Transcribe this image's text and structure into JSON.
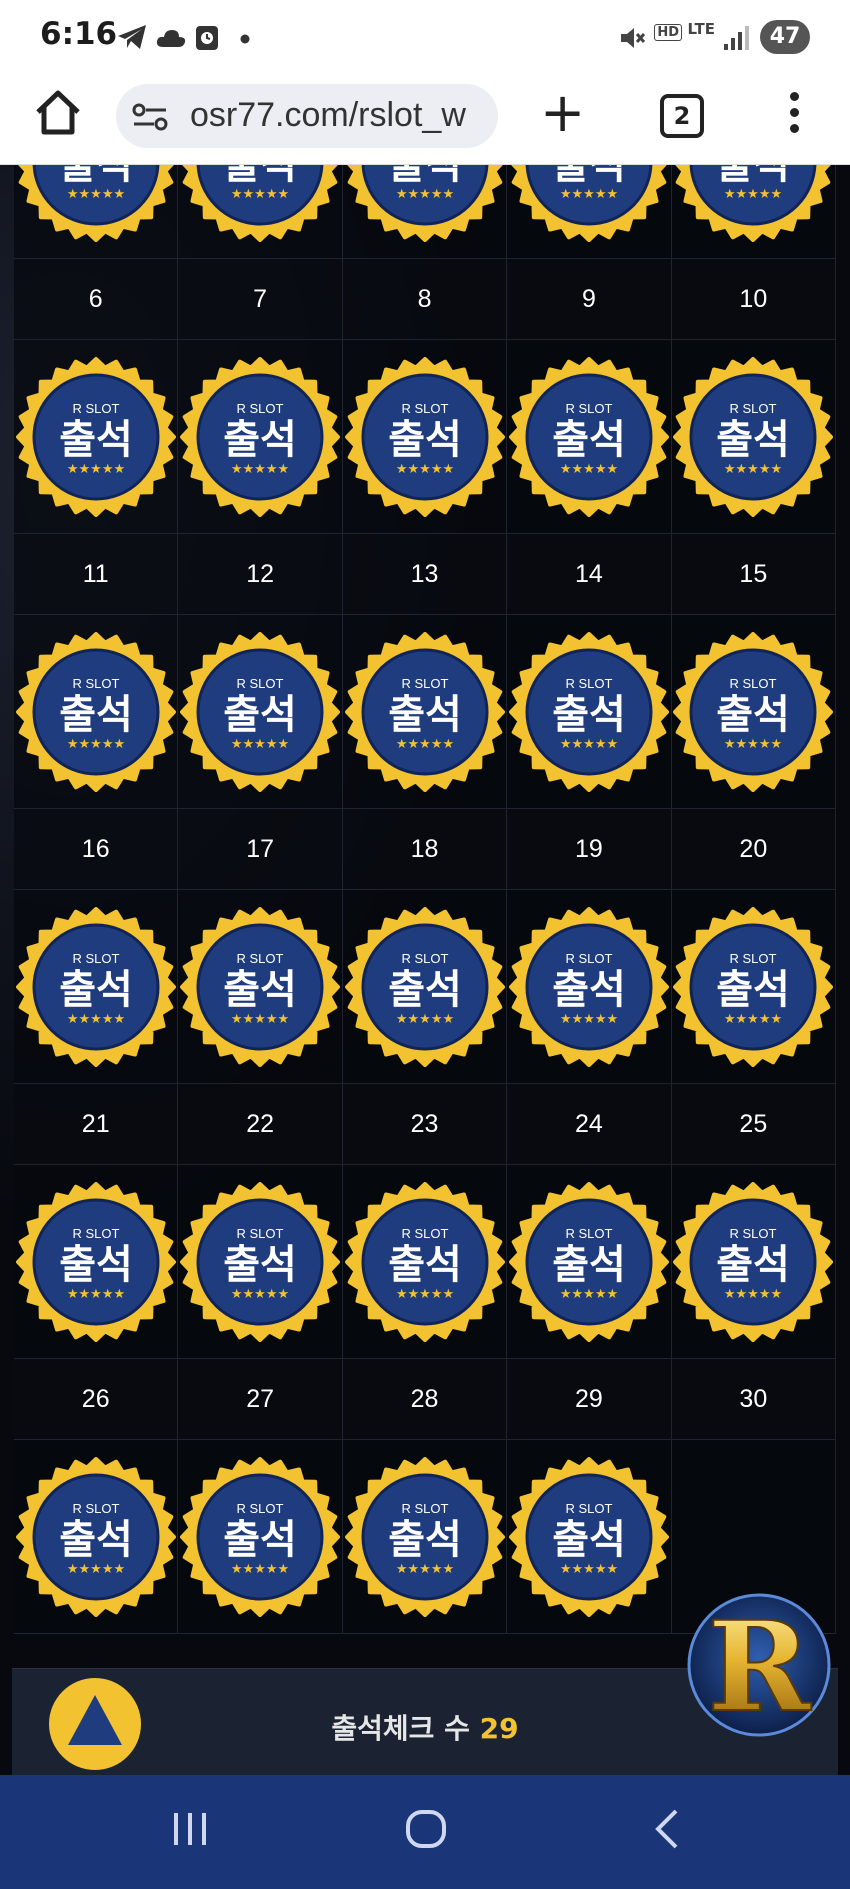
{
  "status_bar": {
    "time": "6:16",
    "battery": "47",
    "network": "LTE",
    "hd_voice": "HD",
    "icons": [
      "telegram-icon",
      "cloud-icon",
      "alarm-icon",
      "dot-icon",
      "mute-icon",
      "signal-icon"
    ]
  },
  "browser": {
    "url": "osr77.com/rslot_w",
    "tab_count": "2",
    "icons": [
      "home-icon",
      "site-info-icon",
      "plus-icon",
      "menu-icon"
    ]
  },
  "calendar": {
    "badge": {
      "brand": "R SLOT",
      "label": "출석",
      "stars": "★★★★★"
    },
    "colors": {
      "badge_blue": "#1f3d7e",
      "badge_gold": "#f2c230"
    },
    "rows": [
      {
        "days": [
          "6",
          "7",
          "8",
          "9",
          "10"
        ],
        "attended": [
          true,
          true,
          true,
          true,
          true
        ]
      },
      {
        "days": [
          "11",
          "12",
          "13",
          "14",
          "15"
        ],
        "attended": [
          true,
          true,
          true,
          true,
          true
        ]
      },
      {
        "days": [
          "16",
          "17",
          "18",
          "19",
          "20"
        ],
        "attended": [
          true,
          true,
          true,
          true,
          true
        ]
      },
      {
        "days": [
          "21",
          "22",
          "23",
          "24",
          "25"
        ],
        "attended": [
          true,
          true,
          true,
          true,
          true
        ]
      },
      {
        "days": [
          "26",
          "27",
          "28",
          "29",
          "30"
        ],
        "attended": [
          true,
          true,
          true,
          true,
          false
        ]
      }
    ],
    "top_partial_row_attended": [
      true,
      true,
      true,
      true,
      true
    ]
  },
  "footer": {
    "check_label": "출석체크 수",
    "check_count": "29",
    "logo_letter": "R"
  },
  "nav": {
    "icons": [
      "recent-apps-icon",
      "home-circle-icon",
      "back-icon"
    ]
  }
}
